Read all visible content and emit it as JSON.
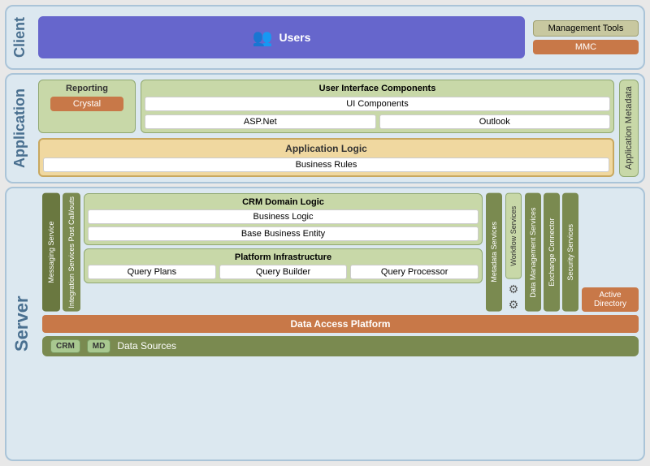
{
  "client": {
    "label": "Client",
    "users": {
      "label": "Users",
      "icon": "👥"
    },
    "management": {
      "title": "Management Tools",
      "mmc": "MMC"
    }
  },
  "application": {
    "label": "Application",
    "reporting": {
      "title": "Reporting",
      "crystal": "Crystal"
    },
    "ui_components": {
      "title": "User Interface Components",
      "ui": "UI Components",
      "aspnet": "ASP.Net",
      "outlook": "Outlook"
    },
    "app_logic": {
      "title": "Application Logic",
      "business_rules": "Business Rules"
    },
    "metadata": "Application Metadata"
  },
  "server": {
    "label": "Server",
    "messaging": "Messaging Service",
    "integration": "Integration Services Post Call/outs",
    "crm_domain": {
      "title": "CRM Domain Logic",
      "business_logic": "Business Logic",
      "base_entity": "Base Business Entity"
    },
    "platform": {
      "title": "Platform Infrastructure",
      "query_plans": "Query Plans",
      "query_builder": "Query Builder",
      "query_processor": "Query Processor"
    },
    "metadata_svc": "Metadata Services",
    "workflow_svc": "Workflow Services",
    "data_mgmt": "Data Management Services",
    "exchange": "Exchange Connector",
    "security": "Security Services",
    "data_access": "Data Access Platform",
    "data_sources": {
      "label": "Data Sources",
      "crm": "CRM",
      "md": "MD"
    },
    "active_directory": "Active Directory"
  }
}
